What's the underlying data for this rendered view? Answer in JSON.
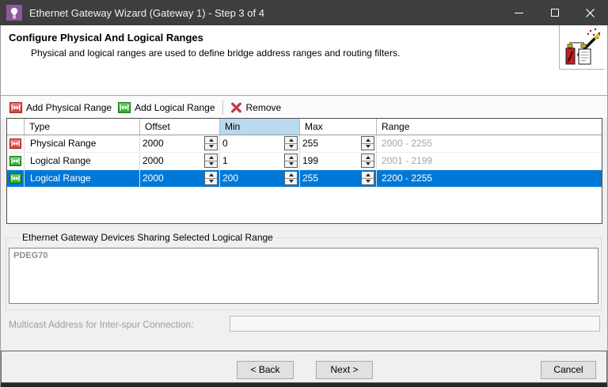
{
  "titlebar": {
    "title": "Ethernet Gateway Wizard (Gateway 1) - Step 3 of 4",
    "app_icon": "lightbulb-icon",
    "icon_color": "#91579e",
    "bar_color": "#3e3e3e"
  },
  "header": {
    "title": "Configure Physical And Logical Ranges",
    "subtitle": "Physical and logical ranges are used to define bridge address ranges and routing filters.",
    "icon": "wizard-wand-icon"
  },
  "toolbar": {
    "add_physical_label": "Add Physical Range",
    "add_logical_label": "Add Logical Range",
    "remove_label": "Remove"
  },
  "table": {
    "columns": {
      "type": "Type",
      "offset": "Offset",
      "min": "Min",
      "max": "Max",
      "range": "Range"
    },
    "highlighted_column": "Min",
    "selection_color": "#0078d7",
    "min_header_highlight": "#b8d9ee",
    "rows": [
      {
        "icon": "physical-range-icon",
        "type": "Physical Range",
        "offset": "2000",
        "min": "0",
        "max": "255",
        "range": "2000 - 2255",
        "selected": false
      },
      {
        "icon": "logical-range-icon",
        "type": "Logical Range",
        "offset": "2000",
        "min": "1",
        "max": "199",
        "range": "2001 - 2199",
        "selected": false
      },
      {
        "icon": "logical-range-icon",
        "type": "Logical Range",
        "offset": "2000",
        "min": "200",
        "max": "255",
        "range": "2200 - 2255",
        "selected": true
      }
    ]
  },
  "devices_group": {
    "title": "Ethernet Gateway Devices Sharing Selected Logical Range",
    "devices": "PDEG70"
  },
  "multicast": {
    "label": "Multicast Address for Inter-spur Connection:",
    "value": ""
  },
  "footer": {
    "back_label": "< Back",
    "next_label": "Next >",
    "cancel_label": "Cancel"
  }
}
